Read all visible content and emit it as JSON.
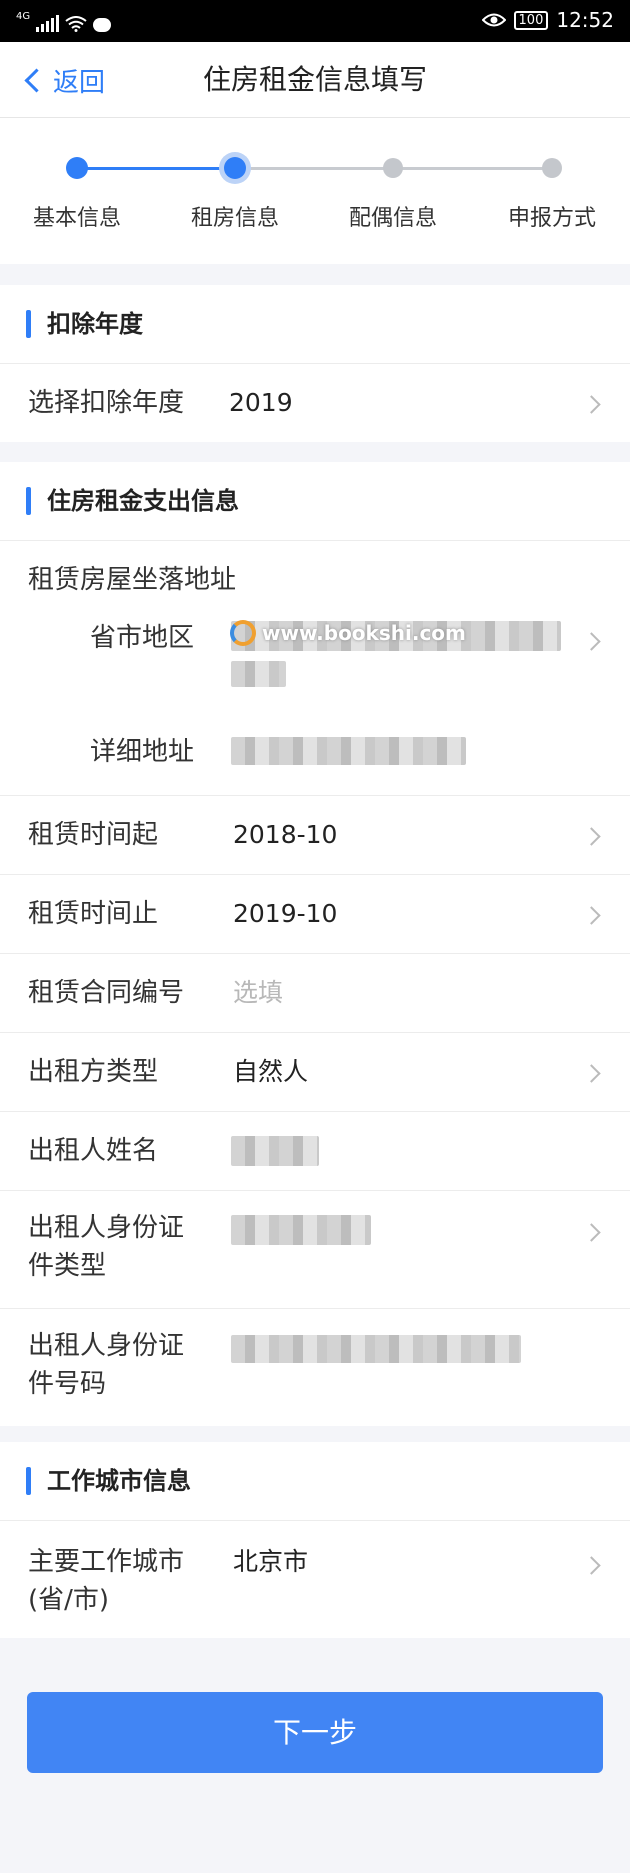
{
  "status_bar": {
    "network": "4G",
    "time": "12:52",
    "battery": "100"
  },
  "header": {
    "back_label": "返回",
    "title": "住房租金信息填写"
  },
  "steps": [
    {
      "label": "基本信息",
      "state": "done"
    },
    {
      "label": "租房信息",
      "state": "current"
    },
    {
      "label": "配偶信息",
      "state": "pending"
    },
    {
      "label": "申报方式",
      "state": "pending"
    }
  ],
  "section_year": {
    "title": "扣除年度",
    "label": "选择扣除年度",
    "value": "2019"
  },
  "section_rent": {
    "title": "住房租金支出信息",
    "address_group_label": "租赁房屋坐落地址",
    "region_label": "省市地区",
    "detail_label": "详细地址",
    "start_label": "租赁时间起",
    "start_value": "2018-10",
    "end_label": "租赁时间止",
    "end_value": "2019-10",
    "contract_label": "租赁合同编号",
    "contract_placeholder": "选填",
    "lessor_type_label": "出租方类型",
    "lessor_type_value": "自然人",
    "lessor_name_label": "出租人姓名",
    "lessor_id_type_label_1": "出租人身份证",
    "lessor_id_type_label_2": "件类型",
    "lessor_id_no_label_1": "出租人身份证",
    "lessor_id_no_label_2": "件号码"
  },
  "section_city": {
    "title": "工作城市信息",
    "label_1": "主要工作城市",
    "label_2": "(省/市)",
    "value": "北京市"
  },
  "next_button": "下一步",
  "watermark": "www.bookshi.com",
  "colors": {
    "accent": "#4185f4",
    "step_active": "#2f7ef7",
    "step_pending": "#c4c7cc"
  }
}
